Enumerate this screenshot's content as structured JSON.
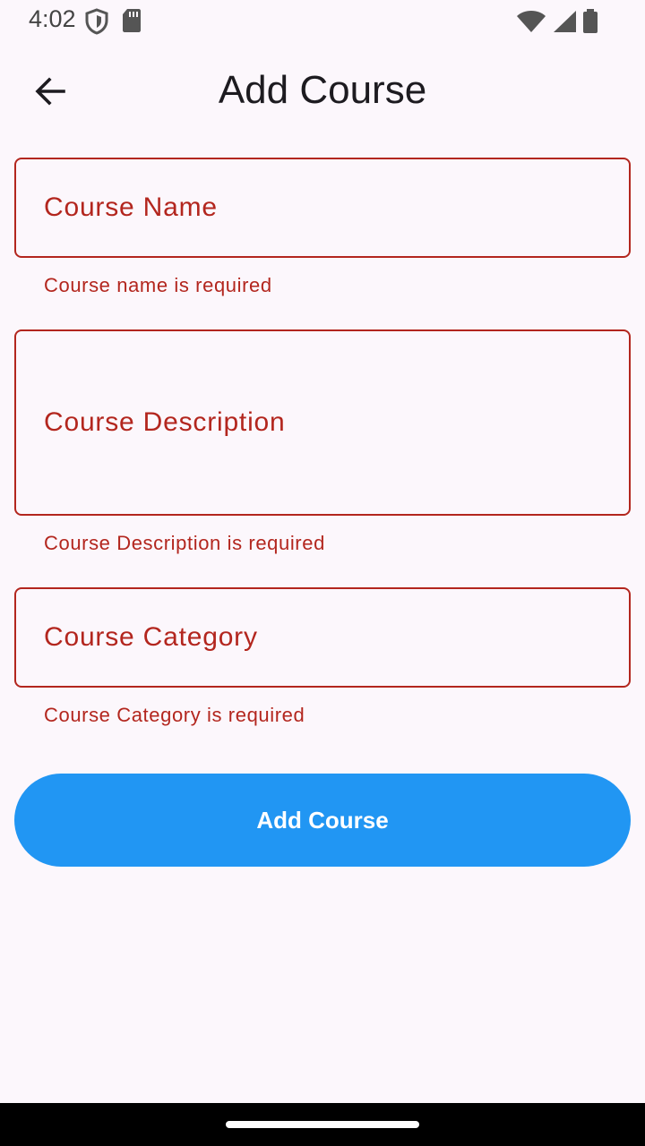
{
  "status_bar": {
    "time": "4:02",
    "icons": [
      "shield-icon",
      "sd-card-icon",
      "wifi-icon",
      "cellular-signal-icon",
      "battery-icon"
    ]
  },
  "app_bar": {
    "title": "Add Course",
    "back_icon": "arrow-left-icon"
  },
  "form": {
    "course_name": {
      "label": "Course Name",
      "error": "Course name is required"
    },
    "course_description": {
      "label": "Course Description",
      "error": "Course Description is required"
    },
    "course_category": {
      "label": "Course Category",
      "error": "Course Category is required"
    },
    "submit_label": "Add Course"
  },
  "colors": {
    "background": "#fcf7fc",
    "error": "#b3261e",
    "primary": "#2196f3",
    "on_primary": "#ffffff"
  }
}
